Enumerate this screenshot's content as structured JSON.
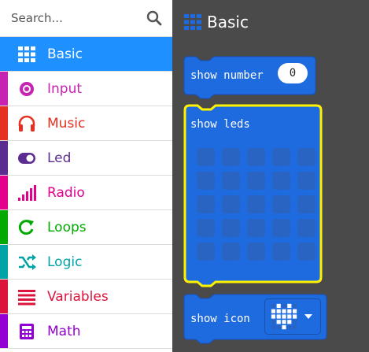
{
  "search": {
    "placeholder": "Search..."
  },
  "categories": [
    {
      "label": "Basic",
      "icon": "grid-icon",
      "color": "#1e90ff",
      "selected": true
    },
    {
      "label": "Input",
      "icon": "target-icon",
      "color": "#c724b1"
    },
    {
      "label": "Music",
      "icon": "headphones-icon",
      "color": "#e63022"
    },
    {
      "label": "Led",
      "icon": "toggle-icon",
      "color": "#5c2d91"
    },
    {
      "label": "Radio",
      "icon": "signal-bars-icon",
      "color": "#e3008c"
    },
    {
      "label": "Loops",
      "icon": "loop-arrow-icon",
      "color": "#00aa00"
    },
    {
      "label": "Logic",
      "icon": "shuffle-icon",
      "color": "#00a4a6"
    },
    {
      "label": "Variables",
      "icon": "list-icon",
      "color": "#dc143c"
    },
    {
      "label": "Math",
      "icon": "calculator-icon",
      "color": "#9400d3"
    }
  ],
  "workspace": {
    "title": "Basic",
    "title_icon": "grid-icon",
    "block_color": "#1e6be0",
    "selected_outline_color": "#fff200",
    "blocks": {
      "show_number": {
        "label": "show number",
        "value": "0"
      },
      "show_leds": {
        "label": "show leds",
        "grid": [
          [
            0,
            0,
            0,
            0,
            0
          ],
          [
            0,
            0,
            0,
            0,
            0
          ],
          [
            0,
            0,
            0,
            0,
            0
          ],
          [
            0,
            0,
            0,
            0,
            0
          ],
          [
            0,
            0,
            0,
            0,
            0
          ]
        ]
      },
      "show_icon": {
        "label": "show icon",
        "icon": "heart-icon"
      }
    }
  }
}
